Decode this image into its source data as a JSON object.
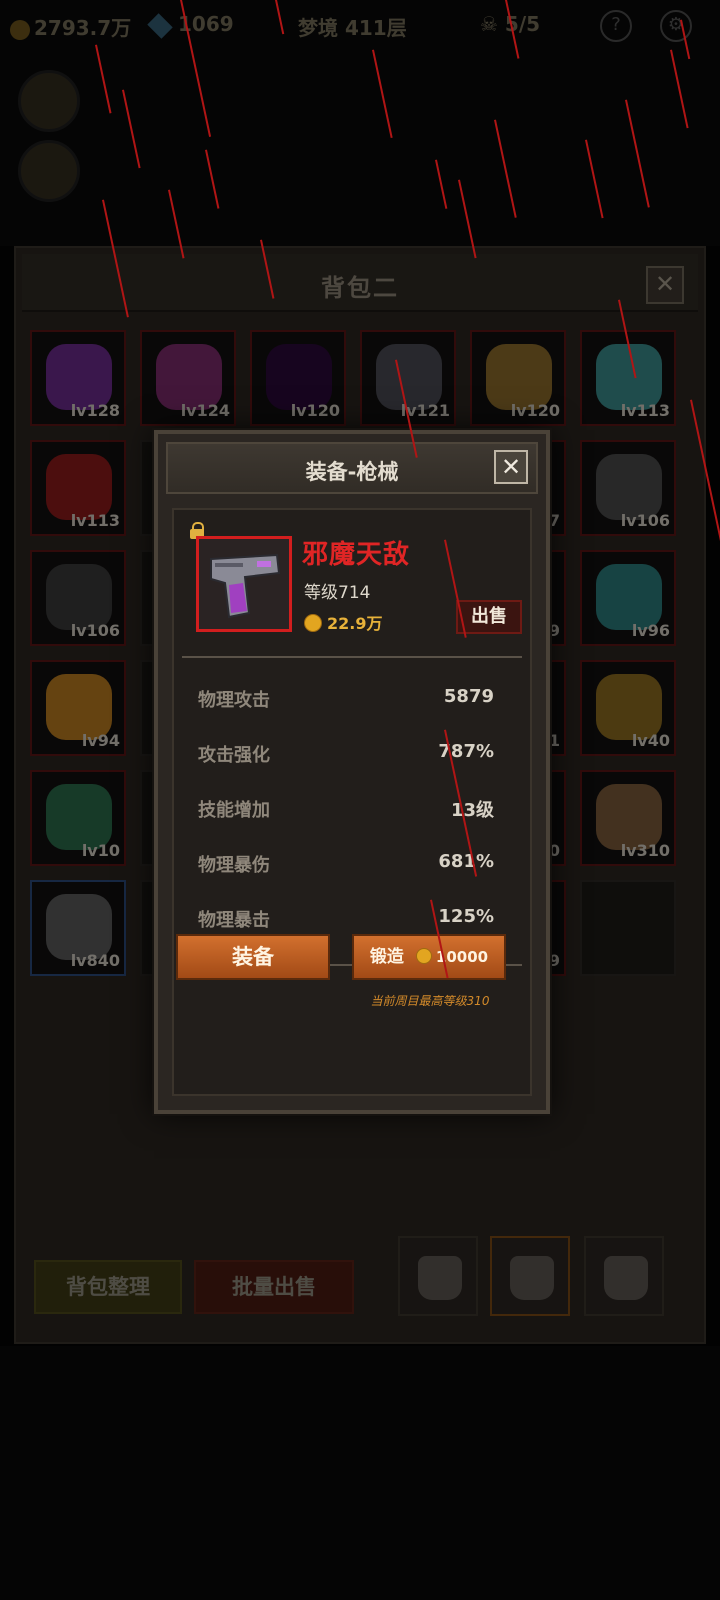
{
  "hud": {
    "gold": "2793.7万",
    "gems": "1069",
    "dungeon": "梦境 411层",
    "counter": "5/5",
    "help": "?"
  },
  "backpack": {
    "title": "背包二",
    "close": "✕",
    "slots": [
      {
        "lv": "lv128",
        "color": "#6a2a8a"
      },
      {
        "lv": "lv124",
        "color": "#7a2a6a"
      },
      {
        "lv": "lv120",
        "color": "#2a0a3a"
      },
      {
        "lv": "lv121",
        "color": "#4a4a52"
      },
      {
        "lv": "lv120",
        "color": "#8a6a2a"
      },
      {
        "lv": "lv113",
        "color": "#3a8a8a"
      },
      {
        "lv": "lv113",
        "color": "#8a1a1a"
      },
      {
        "lv": "",
        "color": ""
      },
      {
        "lv": "",
        "color": ""
      },
      {
        "lv": "",
        "color": ""
      },
      {
        "lv": "7",
        "color": "#3a3a42"
      },
      {
        "lv": "lv106",
        "color": "#4a4a4a"
      },
      {
        "lv": "lv106",
        "color": "#3a3a3a"
      },
      {
        "lv": "",
        "color": ""
      },
      {
        "lv": "",
        "color": ""
      },
      {
        "lv": "",
        "color": ""
      },
      {
        "lv": "9",
        "color": "#2a3a4a"
      },
      {
        "lv": "lv96",
        "color": "#2a7a7a"
      },
      {
        "lv": "lv94",
        "color": "#b87a20"
      },
      {
        "lv": "",
        "color": ""
      },
      {
        "lv": "",
        "color": ""
      },
      {
        "lv": "",
        "color": ""
      },
      {
        "lv": "1",
        "color": "#3a3a3a"
      },
      {
        "lv": "lv40",
        "color": "#8a6a20"
      },
      {
        "lv": "lv10",
        "color": "#2a6a4a"
      },
      {
        "lv": "",
        "color": ""
      },
      {
        "lv": "",
        "color": ""
      },
      {
        "lv": "",
        "color": ""
      },
      {
        "lv": "0",
        "color": "#5a3a7a"
      },
      {
        "lv": "lv310",
        "color": "#7a5a3a"
      },
      {
        "lv": "lv840",
        "color": "#5a5a5a"
      },
      {
        "lv": "",
        "color": ""
      },
      {
        "lv": "",
        "color": ""
      },
      {
        "lv": "",
        "color": ""
      },
      {
        "lv": "9",
        "color": "#6a1a1a"
      },
      {
        "lv": "",
        "color": ""
      }
    ],
    "sort_button": "背包整理",
    "bulk_sell_button": "批量出售"
  },
  "modal": {
    "title": "装备-枪械",
    "close": "✕",
    "item": {
      "name": "邪魔天敌",
      "level": "等级714",
      "price": "22.9万",
      "sell": "出售",
      "locked": true,
      "icon": "pistol-icon"
    },
    "stats": [
      {
        "label": "物理攻击",
        "value": "5879"
      },
      {
        "label": "攻击强化",
        "value": "787%"
      },
      {
        "label": "技能增加",
        "value": "13级"
      },
      {
        "label": "物理暴伤",
        "value": "681%"
      },
      {
        "label": "物理暴击",
        "value": "125%"
      }
    ],
    "equip_button": "装备",
    "forge_button": "锻造",
    "forge_cost": "10000",
    "forge_note": "当前周目最高等级310"
  },
  "colors": {
    "item_name": "#e02525",
    "button": "#c0602a",
    "rarity_border": "#d21e1e",
    "price": "#e8b23a"
  }
}
